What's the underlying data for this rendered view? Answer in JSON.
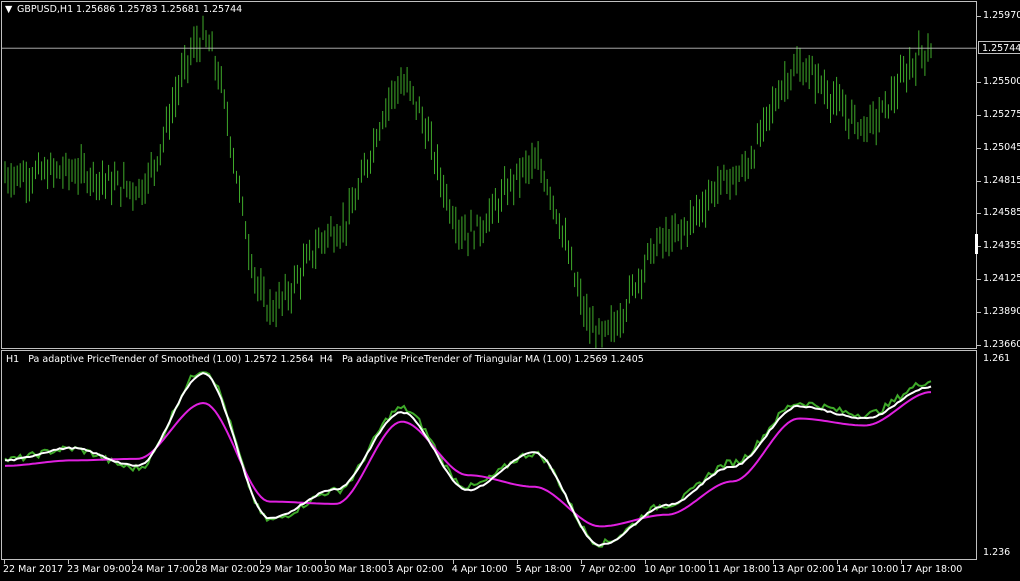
{
  "main": {
    "symbol_tf": "GBPUSD,H1",
    "ohlc": "1.25686 1.25783 1.25681 1.25744",
    "current_price": "1.25744",
    "price_axis": [
      "1.25970",
      "1.25744",
      "1.25500",
      "1.25275",
      "1.25045",
      "1.24815",
      "1.24585",
      "1.24355",
      "1.24125",
      "1.23890",
      "1.23660"
    ]
  },
  "indicator": {
    "label": "H1   Pa adaptive PriceTrender of Smoothed (1.00) 1.2572 1.2564  H4   Pa adaptive PriceTrender of Triangular MA (1.00) 1.2569 1.2405",
    "axis_top": "1.261",
    "axis_bottom": "1.236"
  },
  "time_axis": [
    "22 Mar 2017",
    "23 Mar 09:00",
    "24 Mar 17:00",
    "28 Mar 02:00",
    "29 Mar 10:00",
    "30 Mar 18:00",
    "3 Apr 02:00",
    "4 Apr 10:00",
    "5 Apr 18:00",
    "7 Apr 02:00",
    "10 Apr 10:00",
    "11 Apr 18:00",
    "13 Apr 02:00",
    "14 Apr 10:00",
    "17 Apr 18:00"
  ],
  "colors": {
    "bars": "#3faa2a",
    "line_white": "#ffffff",
    "line_green": "#3faa2a",
    "line_magenta": "#e020e0",
    "grid": "#c0c0c0"
  },
  "chart_data": [
    {
      "type": "line",
      "title": "GBPUSD,H1",
      "xlabel": "",
      "ylabel": "",
      "ylim": [
        1.2366,
        1.2597
      ],
      "x": [
        "22 Mar 2017",
        "23 Mar 09:00",
        "24 Mar 17:00",
        "28 Mar 02:00",
        "29 Mar 10:00",
        "30 Mar 18:00",
        "3 Apr 02:00",
        "4 Apr 10:00",
        "5 Apr 18:00",
        "7 Apr 02:00",
        "10 Apr 10:00",
        "11 Apr 18:00",
        "13 Apr 02:00",
        "14 Apr 10:00",
        "17 Apr 18:00"
      ],
      "series": [
        {
          "values": [
            1.2485,
            1.2488,
            1.2476,
            1.258,
            1.2392,
            1.2446,
            1.2548,
            1.2445,
            1.2492,
            1.2372,
            1.244,
            1.2483,
            1.256,
            1.252,
            1.2574
          ]
        }
      ]
    },
    {
      "type": "line",
      "title": "",
      "ylim": [
        1.236,
        1.261
      ],
      "x": [
        "22 Mar 2017",
        "23 Mar 09:00",
        "24 Mar 17:00",
        "28 Mar 02:00",
        "29 Mar 10:00",
        "30 Mar 18:00",
        "3 Apr 02:00",
        "4 Apr 10:00",
        "5 Apr 18:00",
        "7 Apr 02:00",
        "10 Apr 10:00",
        "11 Apr 18:00",
        "13 Apr 02:00",
        "14 Apr 10:00",
        "17 Apr 18:00"
      ],
      "series": [
        {
          "values": [
            1.2479,
            1.2493,
            1.2468,
            1.2595,
            1.2401,
            1.2439,
            1.2545,
            1.2444,
            1.2487,
            1.2371,
            1.2421,
            1.2475,
            1.2552,
            1.2537,
            1.258
          ]
        },
        {
          "values": [
            1.2478,
            1.2494,
            1.2471,
            1.259,
            1.2403,
            1.2441,
            1.254,
            1.244,
            1.2488,
            1.2369,
            1.242,
            1.247,
            1.2548,
            1.2532,
            1.2573
          ]
        },
        {
          "values": [
            1.2471,
            1.2478,
            1.248,
            1.2552,
            1.2425,
            1.2422,
            1.2528,
            1.2459,
            1.2444,
            1.2393,
            1.2408,
            1.2451,
            1.2532,
            1.2523,
            1.2566
          ]
        }
      ]
    }
  ]
}
